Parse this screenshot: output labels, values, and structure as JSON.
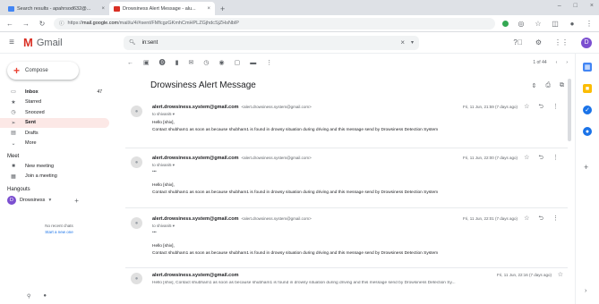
{
  "browser": {
    "tabs": [
      {
        "label": "Search results - apahrsod632@...",
        "close": "×",
        "color": "#4285f4",
        "active": false
      },
      {
        "label": "Drowsiness Alert Message - alu...",
        "close": "×",
        "color": "#d93025",
        "active": true
      }
    ],
    "new_tab": "+",
    "window_controls": [
      "–",
      "□",
      "×"
    ],
    "url_prefix": "https://",
    "url_host": "mail.google.com",
    "url_path": "/mail/u/4/#sent/FMfcgzGKmhCmHPLZGjhdcSjZHsNblP"
  },
  "gmail": {
    "logo_letter": "M",
    "logo_text": "Gmail",
    "search_value": "in:sent",
    "clear": "×",
    "dropdown": "▾",
    "avatar_letter": "D"
  },
  "sidebar": {
    "compose": "Compose",
    "items": [
      {
        "label": "Inbox",
        "count": "47",
        "icon": "▭",
        "bold": true,
        "selected": false
      },
      {
        "label": "Starred",
        "count": "",
        "icon": "★",
        "bold": false,
        "selected": false
      },
      {
        "label": "Snoozed",
        "count": "",
        "icon": "◷",
        "bold": false,
        "selected": false
      },
      {
        "label": "Sent",
        "count": "",
        "icon": "➢",
        "bold": true,
        "selected": true
      },
      {
        "label": "Drafts",
        "count": "",
        "icon": "▤",
        "bold": false,
        "selected": false
      },
      {
        "label": "More",
        "count": "",
        "icon": "⌄",
        "bold": false,
        "selected": false
      }
    ],
    "meet_header": "Meet",
    "meet_items": [
      {
        "label": "New meeting",
        "icon": "■"
      },
      {
        "label": "Join a meeting",
        "icon": "▦"
      }
    ],
    "hangouts_header": "Hangouts",
    "hangouts_user": "Drowsiness",
    "hangouts_caret": "▾",
    "hangouts_add": "+",
    "no_recent": "No recent chats",
    "start_new": "Start a new one"
  },
  "toolbar": {
    "back": "←",
    "pager": "1 of 44"
  },
  "thread": {
    "subject": "Drowsiness Alert Message",
    "messages": [
      {
        "from": "alert.drowsiness.system@gmail.com",
        "from_addr": "<alert.drowsiness.system@gmail.com>",
        "to": "to shivani5 ▾",
        "date": "Fri, 11 Jun, 21:59 (7 days ago)",
        "body1": "Hello [shiv],",
        "body2": "Contact shubham1 as soon as because shubham1 is found in drowsy situation during driving and this message send by Drowsiness Detection System"
      },
      {
        "from": "alert.drowsiness.system@gmail.com",
        "from_addr": "<alert.drowsiness.system@gmail.com>",
        "to": "to shivani5 ▾",
        "dots": "•••",
        "date": "Fri, 11 Jun, 22:00 (7 days ago)",
        "body1": "Hello [shiv],",
        "body2": "Contact shubham1 as soon as because shubham1 is found in drowsy situation during driving and this message send by Drowsiness Detection System"
      },
      {
        "from": "alert.drowsiness.system@gmail.com",
        "from_addr": "<alert.drowsiness.system@gmail.com>",
        "to": "to shivani5 ▾",
        "dots": "•••",
        "date": "Fri, 11 Jun, 22:01 (7 days ago)",
        "body1": "Hello [shiv],",
        "body2": "Contact shubham1 as soon as because shubham1 is found in drowsy situation during driving and this message send by Drowsiness Detection System"
      }
    ],
    "collapsed": {
      "from": "alert.drowsiness.system@gmail.com",
      "date": "Fri, 11 Jun, 22:16 (7 days ago)",
      "snippet": "Hello [shiv], Contact shubham1 as soon as because shubham1 is found in drowsy situation during driving and this message send by Drowsiness Detection Sy..."
    }
  },
  "colors": {
    "gmail_red": "#d93025",
    "selected_bg": "#fce8e6",
    "avatar": "#7b4fd0"
  }
}
